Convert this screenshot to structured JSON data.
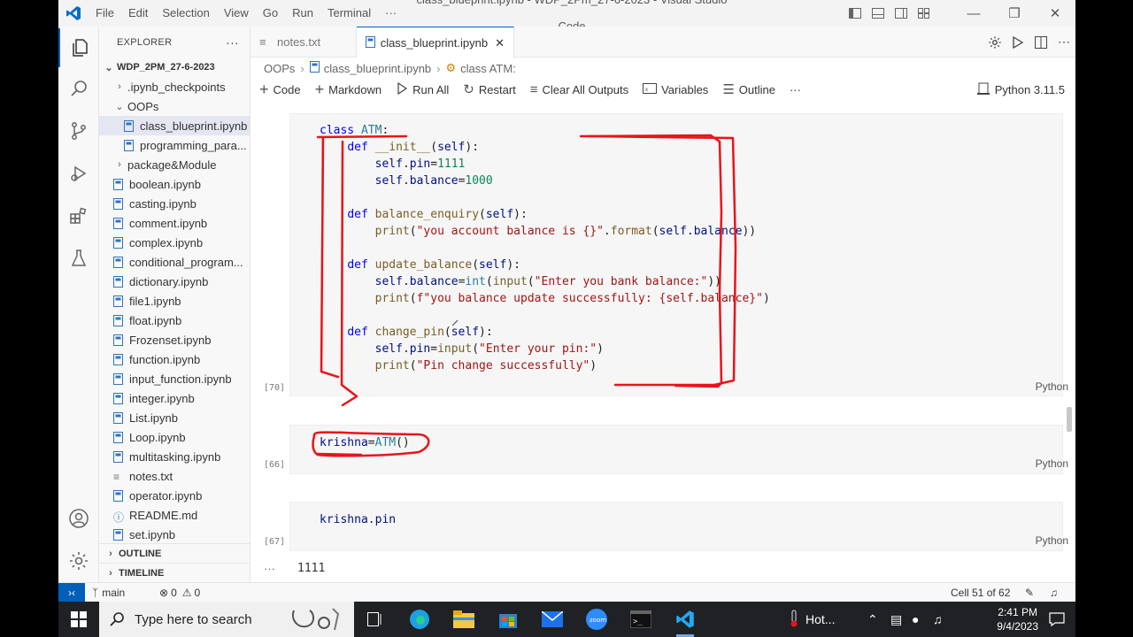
{
  "window": {
    "title": "class_blueprint.ipynb - WDP_2Pm_27-6-2023 - Visual Studio Code",
    "menu": [
      "File",
      "Edit",
      "Selection",
      "View",
      "Go",
      "Run",
      "Terminal",
      "···"
    ]
  },
  "explorer": {
    "header": "EXPLORER",
    "more": "···",
    "root": "WDP_2PM_27-6-2023",
    "items": [
      {
        "label": ".ipynb_checkpoints",
        "type": "folder"
      },
      {
        "label": "OOPs",
        "type": "folder-open"
      },
      {
        "label": "class_blueprint.ipynb",
        "type": "notebook"
      },
      {
        "label": "programming_para...",
        "type": "notebook"
      },
      {
        "label": "package&Module",
        "type": "folder"
      },
      {
        "label": "boolean.ipynb",
        "type": "notebook"
      },
      {
        "label": "casting.ipynb",
        "type": "notebook"
      },
      {
        "label": "comment.ipynb",
        "type": "notebook"
      },
      {
        "label": "complex.ipynb",
        "type": "notebook"
      },
      {
        "label": "conditional_program...",
        "type": "notebook"
      },
      {
        "label": "dictionary.ipynb",
        "type": "notebook"
      },
      {
        "label": "file1.ipynb",
        "type": "notebook"
      },
      {
        "label": "float.ipynb",
        "type": "notebook"
      },
      {
        "label": "Frozenset.ipynb",
        "type": "notebook"
      },
      {
        "label": "function.ipynb",
        "type": "notebook"
      },
      {
        "label": "input_function.ipynb",
        "type": "notebook"
      },
      {
        "label": "integer.ipynb",
        "type": "notebook"
      },
      {
        "label": "List.ipynb",
        "type": "notebook"
      },
      {
        "label": "Loop.ipynb",
        "type": "notebook"
      },
      {
        "label": "multitasking.ipynb",
        "type": "notebook"
      },
      {
        "label": "notes.txt",
        "type": "text"
      },
      {
        "label": "operator.ipynb",
        "type": "notebook"
      },
      {
        "label": "README.md",
        "type": "info"
      },
      {
        "label": "set.ipynb",
        "type": "notebook"
      }
    ],
    "outline": "OUTLINE",
    "timeline": "TIMELINE"
  },
  "tabs": [
    {
      "label": "notes.txt",
      "active": false
    },
    {
      "label": "class_blueprint.ipynb",
      "active": true
    }
  ],
  "breadcrumb": {
    "folder": "OOPs",
    "file": "class_blueprint.ipynb",
    "symbol": "class ATM:"
  },
  "toolbar": {
    "code": "Code",
    "markdown": "Markdown",
    "run_all": "Run All",
    "restart": "Restart",
    "clear_outputs": "Clear All Outputs",
    "variables": "Variables",
    "outline": "Outline",
    "more": "···",
    "kernel": "Python 3.11.5"
  },
  "cells": [
    {
      "exec": "[70]",
      "language": "Python",
      "lines": [
        "class ATM:",
        "    def __init__(self):",
        "        self.pin=1111",
        "        self.balance=1000",
        "",
        "    def balance_enquiry(self):",
        "        print(\"you account balance is {}\".format(self.balance))",
        "",
        "    def update_balance(self):",
        "        self.balance=int(input(\"Enter you bank balance:\"))",
        "        print(f\"you balance update successfully: {self.balance}\")",
        "",
        "    def change_pin(self):",
        "        self.pin=input(\"Enter your pin:\")",
        "        print(\"Pin change successfully\")"
      ]
    },
    {
      "exec": "[66]",
      "language": "Python",
      "lines": [
        "krishna=ATM()"
      ]
    },
    {
      "exec": "[67]",
      "language": "Python",
      "lines": [
        "krishna.pin"
      ],
      "output_dots": "···",
      "output": "1111"
    }
  ],
  "status": {
    "branch": "main",
    "errors": "0",
    "warnings": "0",
    "cell_position": "Cell 51 of 62"
  },
  "taskbar": {
    "search_placeholder": "Type here to search",
    "weather": "Hot...",
    "time": "2:41 PM",
    "date": "9/4/2023"
  },
  "colors": {
    "accent": "#005fb8",
    "annotation": "#e8141b",
    "taskbar": "#1f2125"
  }
}
